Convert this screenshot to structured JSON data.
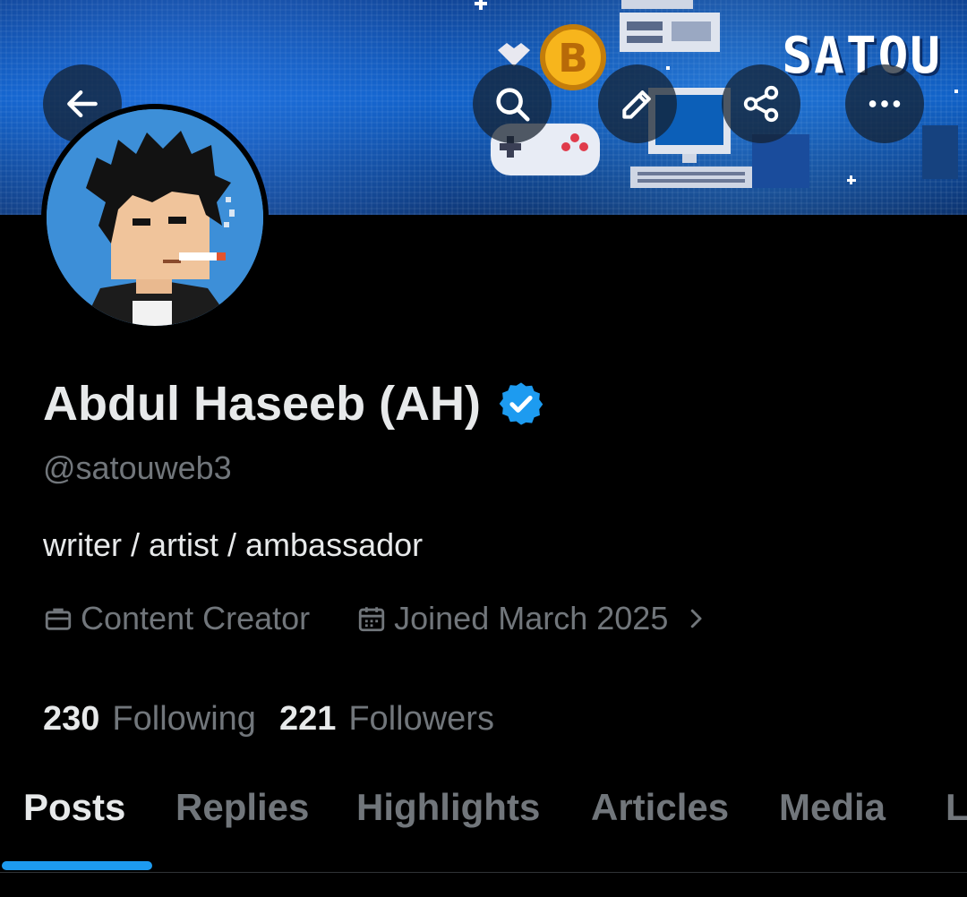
{
  "banner": {
    "brand_text": "SATOU"
  },
  "header_actions": {
    "back": "arrow-left-icon",
    "search": "search-icon",
    "edit": "edit-pen-icon",
    "share": "share-icon",
    "more": "more-horizontal-icon"
  },
  "profile": {
    "display_name": "Abdul Haseeb (AH)",
    "handle": "@satouweb3",
    "bio": "writer / artist / ambassador",
    "category": "Content Creator",
    "joined": "Joined March 2025",
    "verified_color": "#1d9bf0"
  },
  "stats": {
    "following_count": "230",
    "following_label": "Following",
    "followers_count": "221",
    "followers_label": "Followers"
  },
  "tabs": [
    {
      "label": "Posts",
      "active": true
    },
    {
      "label": "Replies"
    },
    {
      "label": "Highlights"
    },
    {
      "label": "Articles"
    },
    {
      "label": "Media"
    },
    {
      "label": "L"
    }
  ],
  "colors": {
    "accent": "#1d9bf0",
    "muted": "#71767b",
    "text": "#e7e9ea",
    "background": "#000000"
  }
}
